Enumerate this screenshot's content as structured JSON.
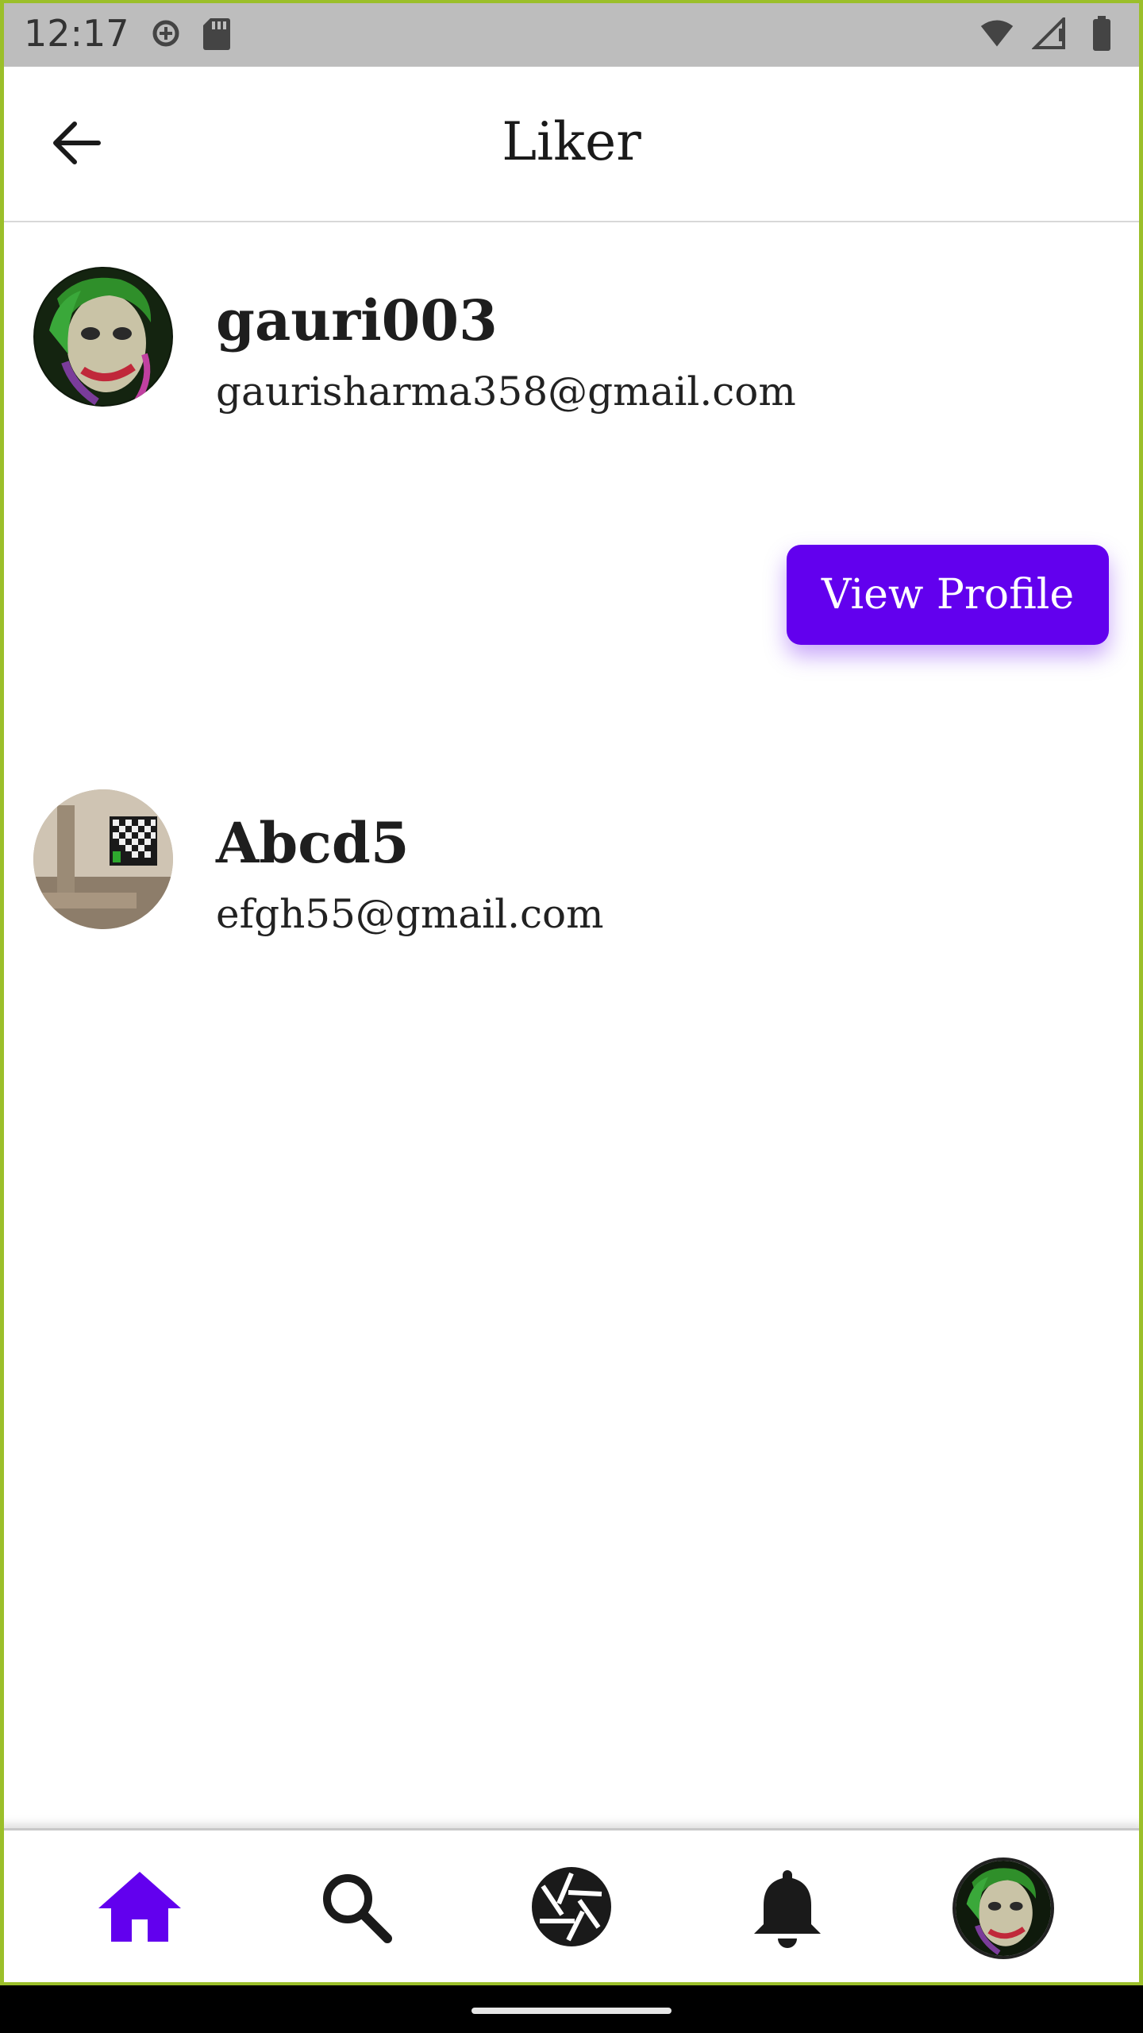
{
  "status_bar": {
    "time": "12:17",
    "icons": [
      "data-saver-icon",
      "sd-card-icon",
      "wifi-icon",
      "signal-icon",
      "battery-icon"
    ]
  },
  "app_bar": {
    "title": "Liker",
    "back_icon": "arrow-left-icon"
  },
  "likers": [
    {
      "username": "gauri003",
      "email": "gaurisharma358@gmail.com",
      "avatar": "joker-portrait"
    },
    {
      "username": "Abcd5",
      "email": "efgh55@gmail.com",
      "avatar": "room-photo"
    }
  ],
  "view_profile_label": "View Profile",
  "bottom_nav": {
    "items": [
      "home-icon",
      "search-icon",
      "camera-shutter-icon",
      "bell-icon",
      "profile-avatar"
    ],
    "active": "home-icon"
  },
  "colors": {
    "accent": "#6200ee",
    "status_bar": "#bdbdbd",
    "frame": "#9bbf2a"
  }
}
